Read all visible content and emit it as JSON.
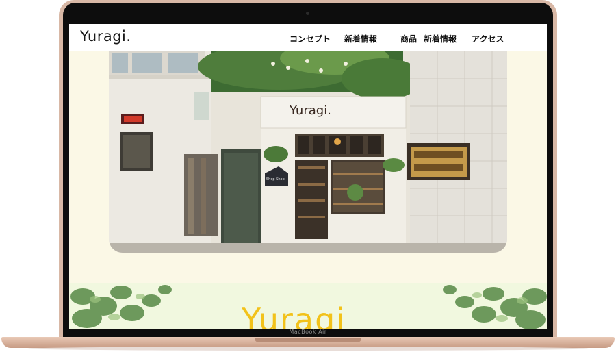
{
  "site": {
    "logo": "Yuragi.",
    "nav": [
      "コンセプト",
      "新着情報",
      "商品",
      "新着情報",
      "アクセス"
    ]
  },
  "hero": {
    "shop_sign": "Yuragi.",
    "hanging_sign": "Shop Shop"
  },
  "section2": {
    "brand_text": "Yuragi"
  },
  "device": {
    "model_label": "MacBook Air"
  },
  "colors": {
    "page_bg": "#fbf8e6",
    "accent_yellow": "#f2c21a",
    "laptop_gold": "#d8b8a6",
    "ivy_green": "#5f8f4e"
  }
}
